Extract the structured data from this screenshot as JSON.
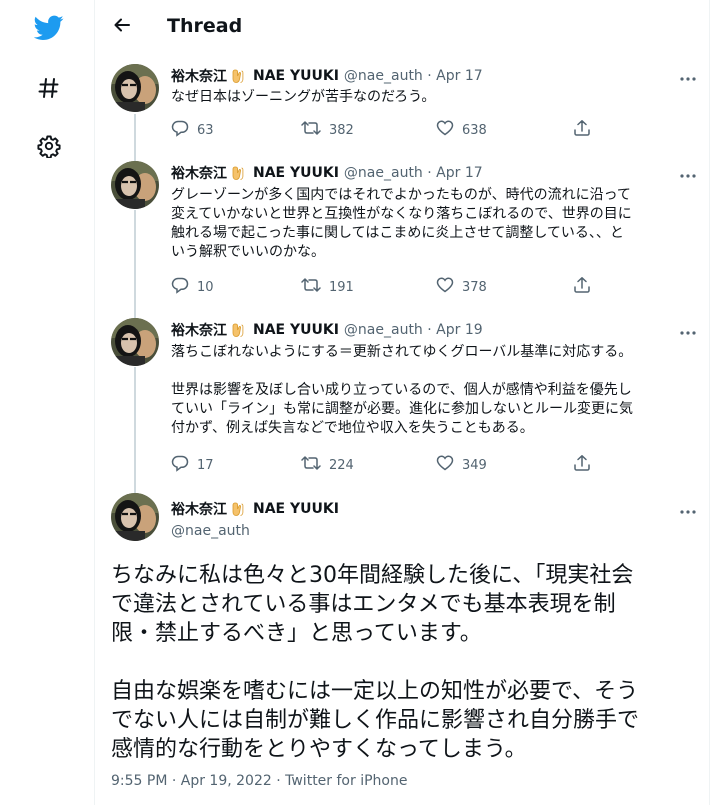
{
  "nav": {
    "items": [
      {
        "icon": "twitter-bird-icon"
      },
      {
        "icon": "hashtag-icon"
      },
      {
        "icon": "gear-icon"
      }
    ],
    "brand_color": "#1d9bf0"
  },
  "header": {
    "title": "Thread"
  },
  "author": {
    "display_name": "裕木奈江",
    "badge_icon": "hands-emoji-icon",
    "latin_name": "NAE YUUKI",
    "handle": "@nae_auth"
  },
  "tweets": [
    {
      "handle_date": "@nae_auth · Apr 17",
      "text": "なぜ日本はゾーニングが苦手なのだろう。",
      "replies": "63",
      "retweets": "382",
      "likes": "638"
    },
    {
      "handle_date": "@nae_auth · Apr 17",
      "text": "グレーゾーンが多く国内ではそれでよかったものが、時代の流れに沿って\n変えていかないと世界と互換性がなくなり落ちこぼれるので、世界の目に\n触れる場で起こった事に関してはこまめに炎上させて調整している、、と\nいう解釈でいいのかな。",
      "replies": "10",
      "retweets": "191",
      "likes": "378"
    },
    {
      "handle_date": "@nae_auth · Apr 19",
      "text": "落ちこぼれないようにする＝更新されてゆくグローバル基準に対応する。\n\n世界は影響を及ぼし合い成り立っているので、個人が感情や利益を優先し\nていい「ライン」も常に調整が必要。進化に参加しないとルール変更に気\n付かず、例えば失言などで地位や収入を失うこともある。",
      "replies": "17",
      "retweets": "224",
      "likes": "349"
    }
  ],
  "main_tweet": {
    "handle": "@nae_auth",
    "text": "ちなみに私は色々と30年間経験した後に、「現実社会\nで違法とされている事はエンタメでも基本表現を制\n限・禁止するべき」と思っています。\n\n自由な娯楽を嗜むには一定以上の知性が必要で、そう\nでない人には自制が難しく作品に影響され自分勝手で\n感情的な行動をとりやすくなってしまう。",
    "meta": "9:55 PM · Apr 19, 2022 · Twitter for iPhone"
  }
}
